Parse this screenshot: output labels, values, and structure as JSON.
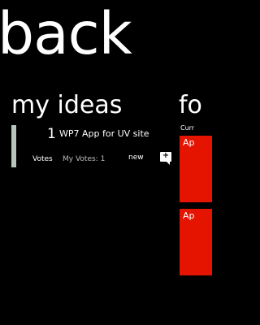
{
  "panorama": {
    "title": "back"
  },
  "my_ideas": {
    "title": "my ideas",
    "items": [
      {
        "votes": "1",
        "title": "WP7 App for UV site",
        "votes_label": "Votes",
        "my_votes": "My Votes: 1",
        "status": "new",
        "comment_icon": "comment-plus-icon",
        "comment_glyph": "+"
      }
    ]
  },
  "forum": {
    "title": "fo",
    "subtitle": "Curr",
    "tiles": [
      {
        "label": "Ap"
      },
      {
        "label": "Ap"
      }
    ]
  },
  "colors": {
    "background": "#000000",
    "accent": "#e51400",
    "vote_bar": "#b7c5bd"
  }
}
